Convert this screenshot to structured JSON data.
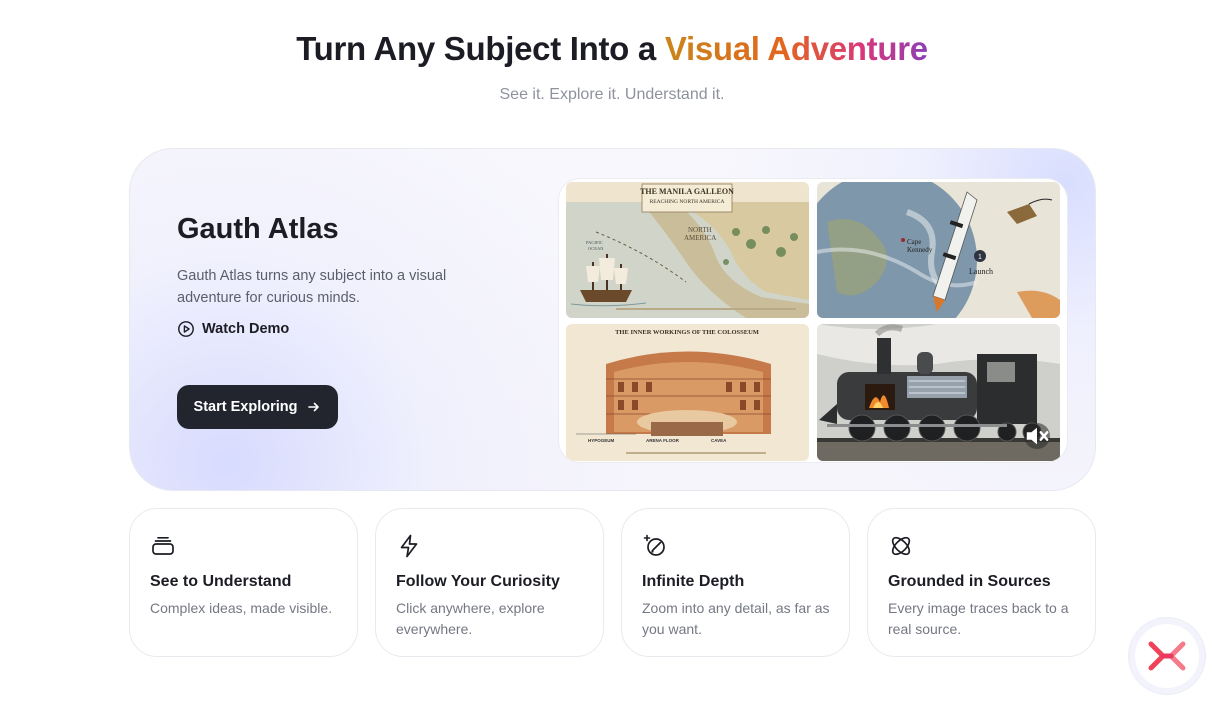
{
  "hero": {
    "title_prefix": "Turn Any Subject Into a ",
    "title_accent": "Visual Adventure",
    "subtitle": "See it. Explore it. Understand it."
  },
  "product": {
    "name": "Gauth Atlas",
    "description": "Gauth Atlas turns any subject into a visual adventure for curious minds.",
    "watch_demo_label": "Watch Demo",
    "cta_label": "Start Exploring",
    "icons": [
      "play-circle-icon",
      "arrow-right-icon",
      "mute-icon"
    ]
  },
  "gallery": {
    "tiles": [
      {
        "title": "THE MANILA GALLEON",
        "subtitle": "REACHING NORTH AMERICA",
        "labels": [
          "NORTH",
          "AMERICA",
          "PACIFIC",
          "OCEAN"
        ]
      },
      {
        "labels": [
          "Cape",
          "Kennedy",
          "1",
          "Launch"
        ]
      },
      {
        "title": "THE INNER WORKINGS OF THE COLOSSEUM",
        "labels": [
          "HYPOGEUM",
          "ARENA FLOOR",
          "CAVEA"
        ]
      },
      {
        "labels": []
      }
    ]
  },
  "features": [
    {
      "icon": "layers-icon",
      "title": "See to Understand",
      "description": "Complex ideas, made visible."
    },
    {
      "icon": "lightning-icon",
      "title": "Follow Your Curiosity",
      "description": "Click anywhere, explore everywhere."
    },
    {
      "icon": "sparkle-pen-icon",
      "title": "Infinite Depth",
      "description": "Zoom into any detail, as far as you want."
    },
    {
      "icon": "orbit-icon",
      "title": "Grounded in Sources",
      "description": "Every image traces back to a real source."
    }
  ],
  "fab": {
    "icon": "gauth-logo-icon"
  },
  "colors": {
    "accent_gradient": [
      "#c9861a",
      "#e2661e",
      "#d9377a",
      "#8a3fb5"
    ],
    "button_dark": "#23252e",
    "text_primary": "#1c1d24",
    "text_muted": "#8e929c",
    "logo_red": "#f0435a"
  }
}
